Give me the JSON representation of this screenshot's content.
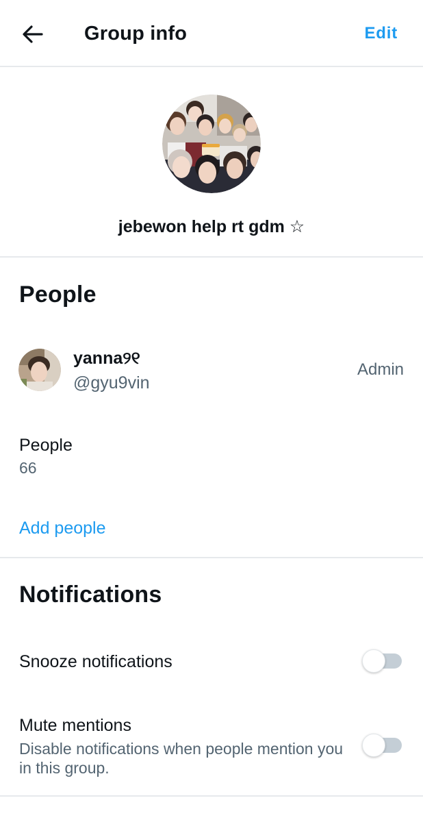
{
  "header": {
    "title": "Group info",
    "edit_label": "Edit",
    "back_icon": "arrow-left-icon"
  },
  "group": {
    "name": "jebewon help rt gdm ☆",
    "avatar": "group-photo"
  },
  "people": {
    "heading": "People",
    "members": [
      {
        "name": "yanna୨୧",
        "handle": "@gyu9vin",
        "role": "Admin"
      }
    ],
    "count_label": "People",
    "count": "66",
    "add_label": "Add people"
  },
  "notifications": {
    "heading": "Notifications",
    "snooze": {
      "label": "Snooze notifications",
      "enabled": false
    },
    "mute_mentions": {
      "label": "Mute mentions",
      "description": "Disable notifications when people mention you in this group.",
      "enabled": false
    }
  },
  "colors": {
    "accent": "#1d9bf0",
    "text": "#0f1419",
    "secondary_text": "#536471",
    "divider": "#e6e9ec",
    "toggle_off_track": "#c4ced6"
  }
}
